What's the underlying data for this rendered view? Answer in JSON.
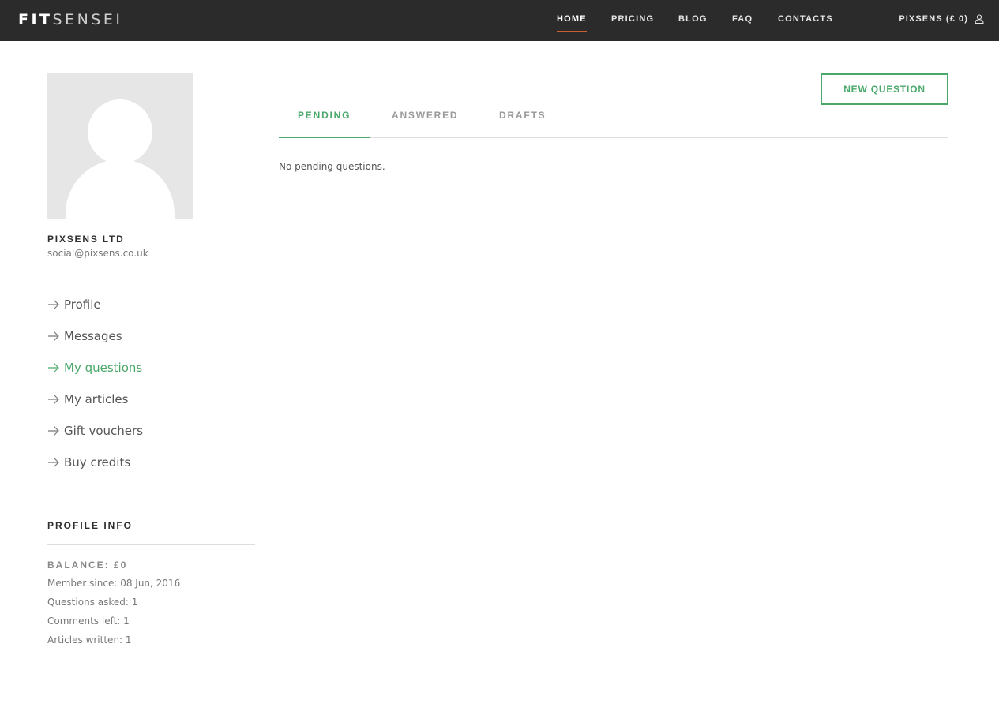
{
  "header": {
    "logo_fit": "FIT",
    "logo_sensei": "SENSEI",
    "nav": {
      "home": "HOME",
      "pricing": "PRICING",
      "blog": "BLOG",
      "faq": "FAQ",
      "contacts": "CONTACTS"
    },
    "active_nav": "home",
    "account_label": "PIXSENS (£ 0)",
    "account_icon": "user-icon"
  },
  "sidebar": {
    "company": "PIXSENS LTD",
    "email": "social@pixsens.co.uk",
    "menu": [
      {
        "label": "Profile",
        "active": false
      },
      {
        "label": "Messages",
        "active": false
      },
      {
        "label": "My questions",
        "active": true
      },
      {
        "label": "My articles",
        "active": false
      },
      {
        "label": "Gift vouchers",
        "active": false
      },
      {
        "label": "Buy credits",
        "active": false
      }
    ],
    "menu_icon": "arrow-right-icon",
    "profile_info_title": "PROFILE INFO",
    "balance": "BALANCE: £0",
    "stats": {
      "member_since": "Member since: 08 Jun, 2016",
      "questions_asked": "Questions asked: 1",
      "comments_left": "Comments left: 1",
      "articles_written": "Articles written: 1"
    }
  },
  "main": {
    "new_question_label": "NEW QUESTION",
    "tabs": [
      {
        "label": "PENDING",
        "active": true
      },
      {
        "label": "ANSWERED",
        "active": false
      },
      {
        "label": "DRAFTS",
        "active": false
      }
    ],
    "empty_message": "No pending questions."
  },
  "colors": {
    "accent_green": "#4aa86a",
    "nav_background": "#2b2b2b",
    "nav_active_underline": "#c9602f"
  }
}
